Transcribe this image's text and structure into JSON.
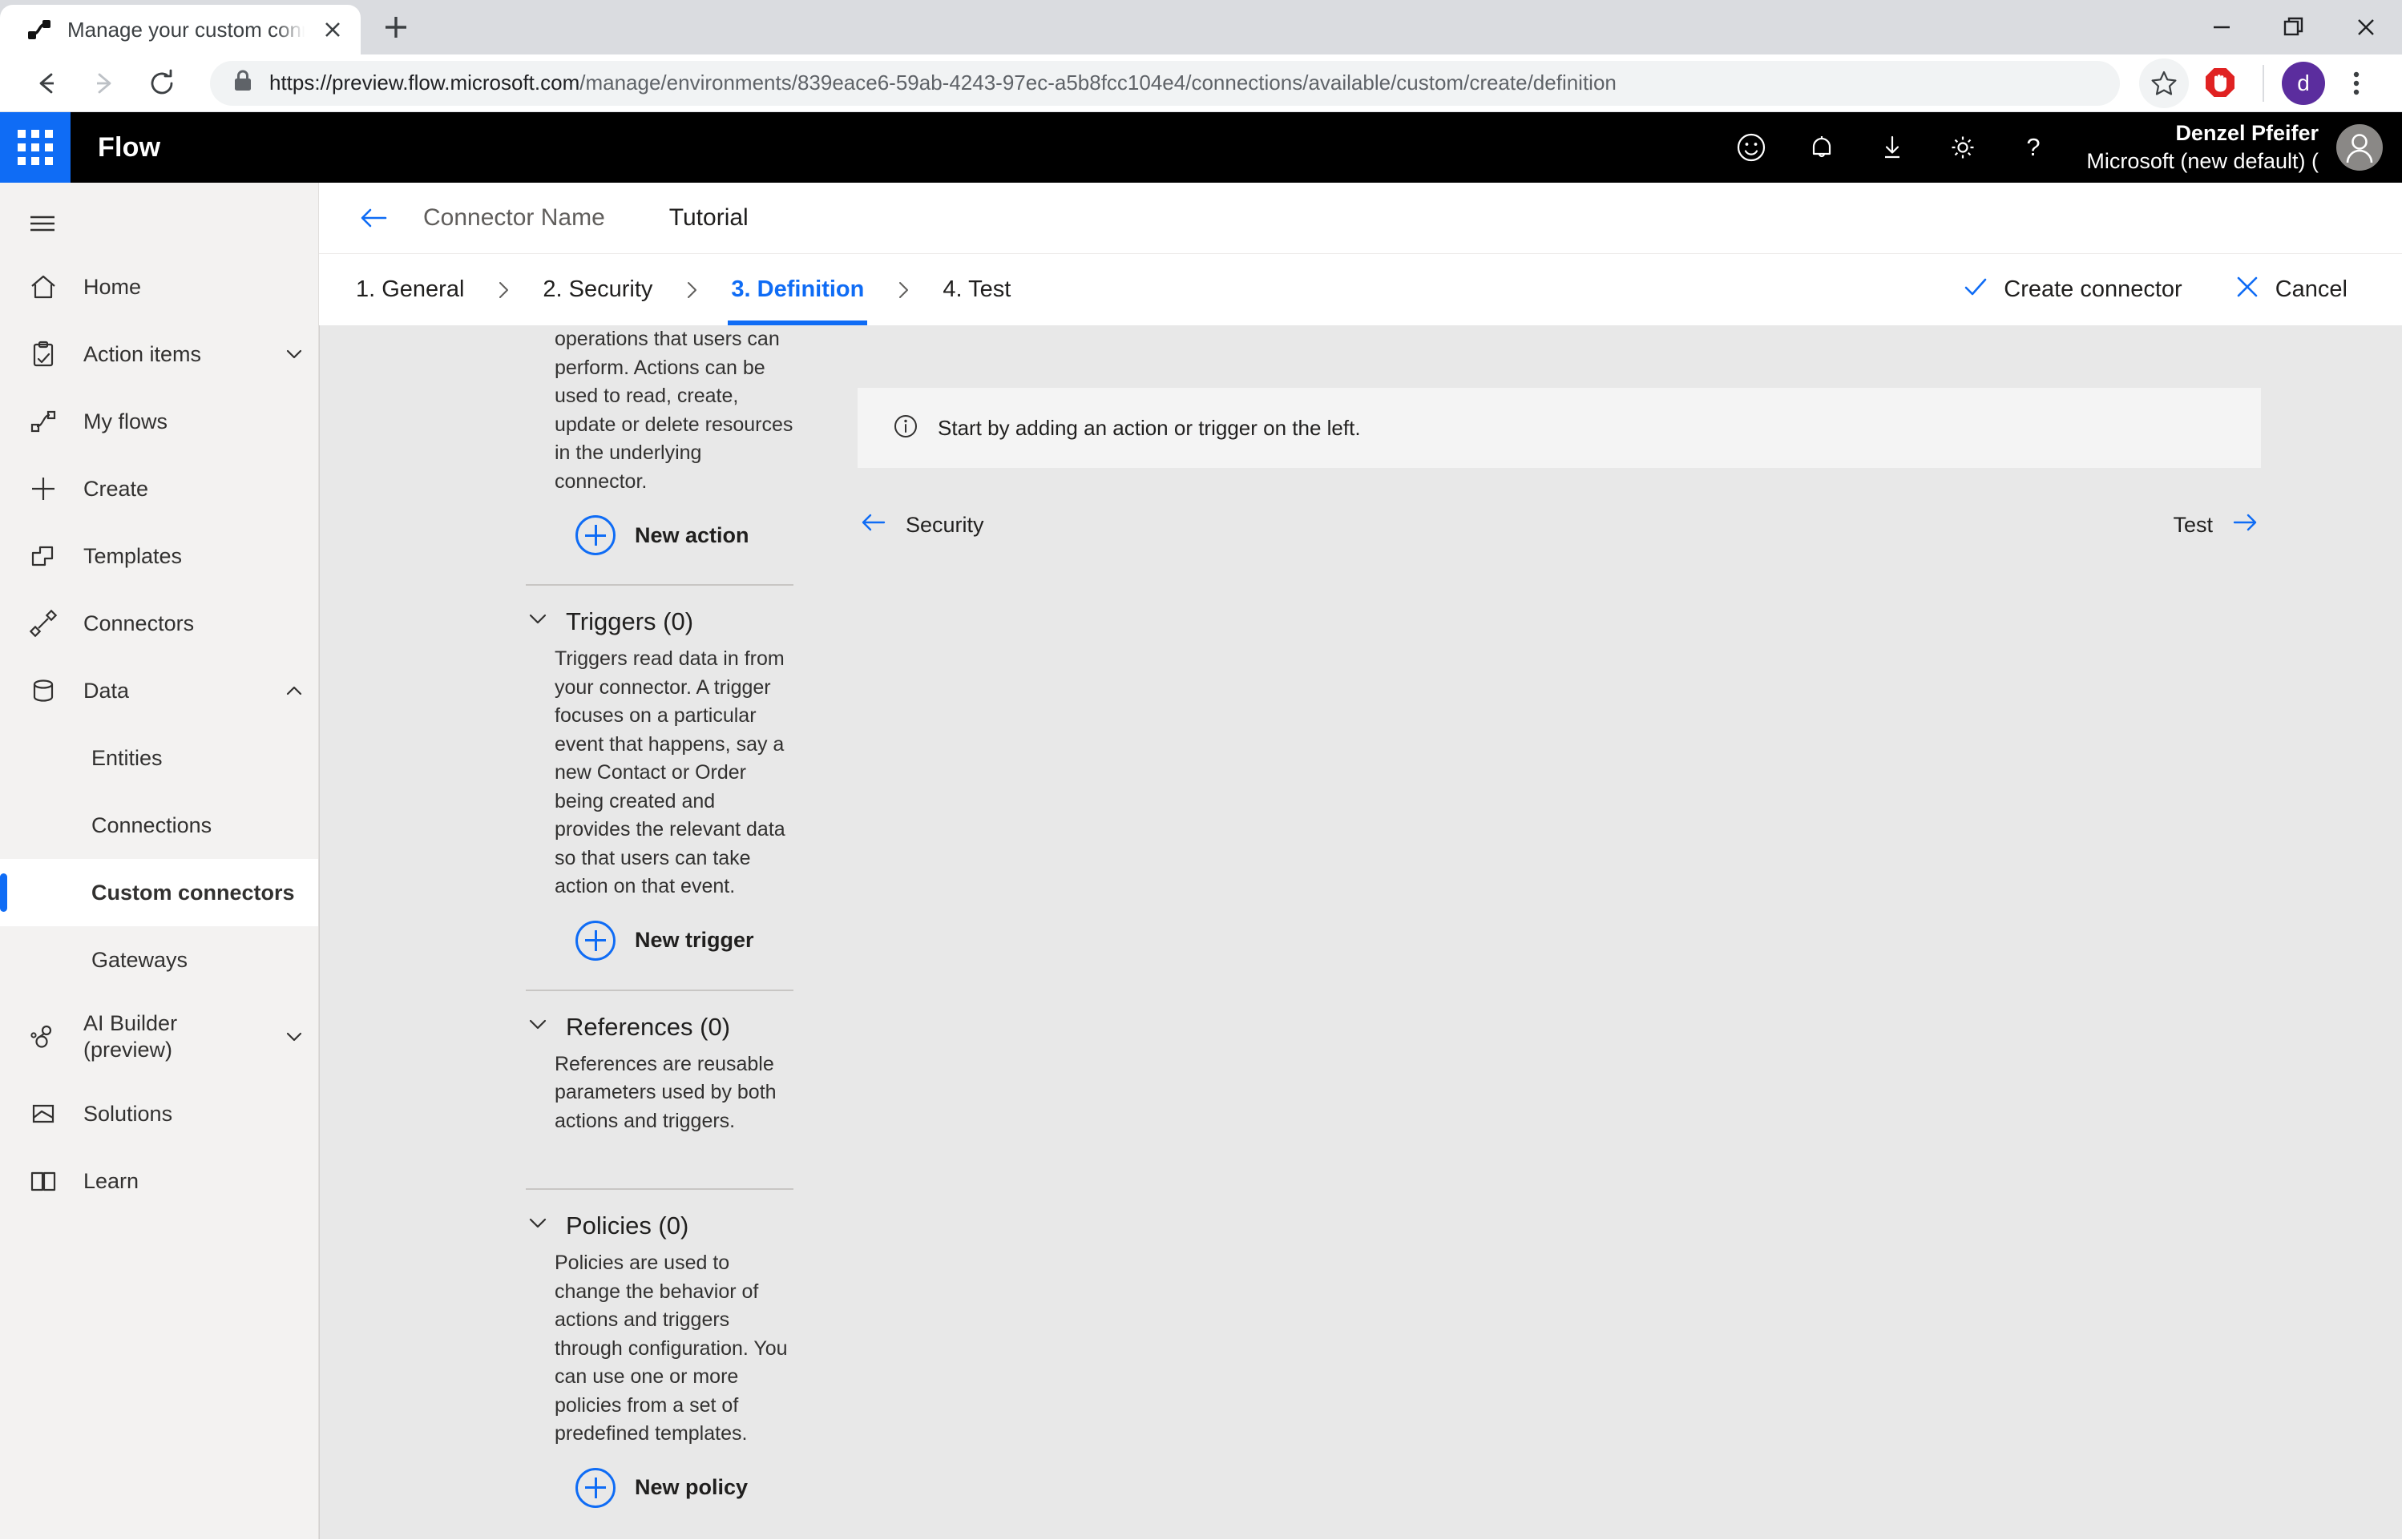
{
  "browser": {
    "tab": {
      "title": "Manage your custom connectors",
      "favicon": "flow-icon",
      "close": "close-icon"
    },
    "new_tab_label": "+",
    "window": {
      "minimize": "minimize-icon",
      "restore": "restore-icon",
      "close": "close-icon"
    },
    "toolbar": {
      "back": "back-arrow-icon",
      "forward": "forward-arrow-icon",
      "reload": "reload-icon",
      "lock": "lock-icon",
      "url_host": "https://preview.flow.microsoft.com",
      "url_path": "/manage/environments/839eace6-59ab-4243-97ec-a5b8fcc104e4/connections/available/custom/create/definition",
      "bookmark": "star-icon",
      "adblock": "adblock-shield-icon",
      "profile_initial": "d",
      "menu": "three-dot-menu-icon"
    }
  },
  "suite": {
    "waffle": "app-launcher-icon",
    "brand": "Flow",
    "icons": [
      "smiley-icon",
      "bell-icon",
      "download-icon",
      "gear-icon",
      "help-icon"
    ],
    "user_name": "Denzel Pfeifer",
    "user_org": "Microsoft (new default) (",
    "avatar": "user-avatar-icon"
  },
  "sidebar": {
    "hamburger": "hamburger-icon",
    "items": [
      {
        "label": "Home",
        "icon": "home-icon",
        "chevron": "",
        "level": "top",
        "selected": false
      },
      {
        "label": "Action items",
        "icon": "clipboard-check-icon",
        "chevron": "chevron-down-icon",
        "level": "top",
        "selected": false
      },
      {
        "label": "My flows",
        "icon": "flow-icon",
        "chevron": "",
        "level": "top",
        "selected": false
      },
      {
        "label": "Create",
        "icon": "plus-icon",
        "chevron": "",
        "level": "top",
        "selected": false
      },
      {
        "label": "Templates",
        "icon": "templates-icon",
        "chevron": "",
        "level": "top",
        "selected": false
      },
      {
        "label": "Connectors",
        "icon": "connector-plug-icon",
        "chevron": "",
        "level": "top",
        "selected": false
      },
      {
        "label": "Data",
        "icon": "database-icon",
        "chevron": "chevron-up-icon",
        "level": "top",
        "selected": false
      },
      {
        "label": "Entities",
        "icon": "",
        "chevron": "",
        "level": "sub",
        "selected": false
      },
      {
        "label": "Connections",
        "icon": "",
        "chevron": "",
        "level": "sub",
        "selected": false
      },
      {
        "label": "Custom connectors",
        "icon": "",
        "chevron": "",
        "level": "sub",
        "selected": true
      },
      {
        "label": "Gateways",
        "icon": "",
        "chevron": "",
        "level": "sub",
        "selected": false
      },
      {
        "label": "AI Builder (preview)",
        "icon": "ai-builder-icon",
        "chevron": "chevron-down-icon",
        "level": "top",
        "selected": false
      },
      {
        "label": "Solutions",
        "icon": "solutions-icon",
        "chevron": "",
        "level": "top",
        "selected": false
      },
      {
        "label": "Learn",
        "icon": "book-icon",
        "chevron": "",
        "level": "top",
        "selected": false
      }
    ]
  },
  "breadcrumb": {
    "back": "back-arrow-icon",
    "connector_name": "Connector Name",
    "title": "Tutorial"
  },
  "wizard": {
    "steps": [
      {
        "label": "1. General",
        "active": false
      },
      {
        "label": "2. Security",
        "active": false
      },
      {
        "label": "3. Definition",
        "active": true
      },
      {
        "label": "4. Test",
        "active": false
      }
    ],
    "separator": "chevron-right-icon",
    "create_label": "Create connector",
    "create_icon": "checkmark-icon",
    "cancel_label": "Cancel",
    "cancel_icon": "close-x-icon"
  },
  "definition": {
    "actions_trailing_text": "operations that users can perform. Actions can be used to read, create, update or delete resources in the underlying connector.",
    "new_action_label": "New action",
    "sections": [
      {
        "title": "Triggers (0)",
        "chevron": "chevron-down-icon",
        "description": "Triggers read data in from your connector. A trigger focuses on a particular event that happens, say a new Contact or Order being created and provides the relevant data so that users can take action on that event.",
        "button": "New trigger"
      },
      {
        "title": "References (0)",
        "chevron": "chevron-down-icon",
        "description": "References are reusable parameters used by both actions and triggers.",
        "button": ""
      },
      {
        "title": "Policies (0)",
        "chevron": "chevron-down-icon",
        "description": "Policies are used to change the behavior of actions and triggers through configuration. You can use one or more policies from a set of predefined templates.",
        "button": "New policy"
      }
    ]
  },
  "detail_pane": {
    "info_icon": "info-icon",
    "info_text": "Start by adding an action or trigger on the left.",
    "prev_label": "Security",
    "prev_icon": "left-arrow-icon",
    "next_label": "Test",
    "next_icon": "right-arrow-icon"
  },
  "colors": {
    "accent": "#0f6cf5",
    "suite_bar": "#000000",
    "sidebar_bg": "#f3f2f1",
    "content_bg": "#e8e8e8"
  }
}
